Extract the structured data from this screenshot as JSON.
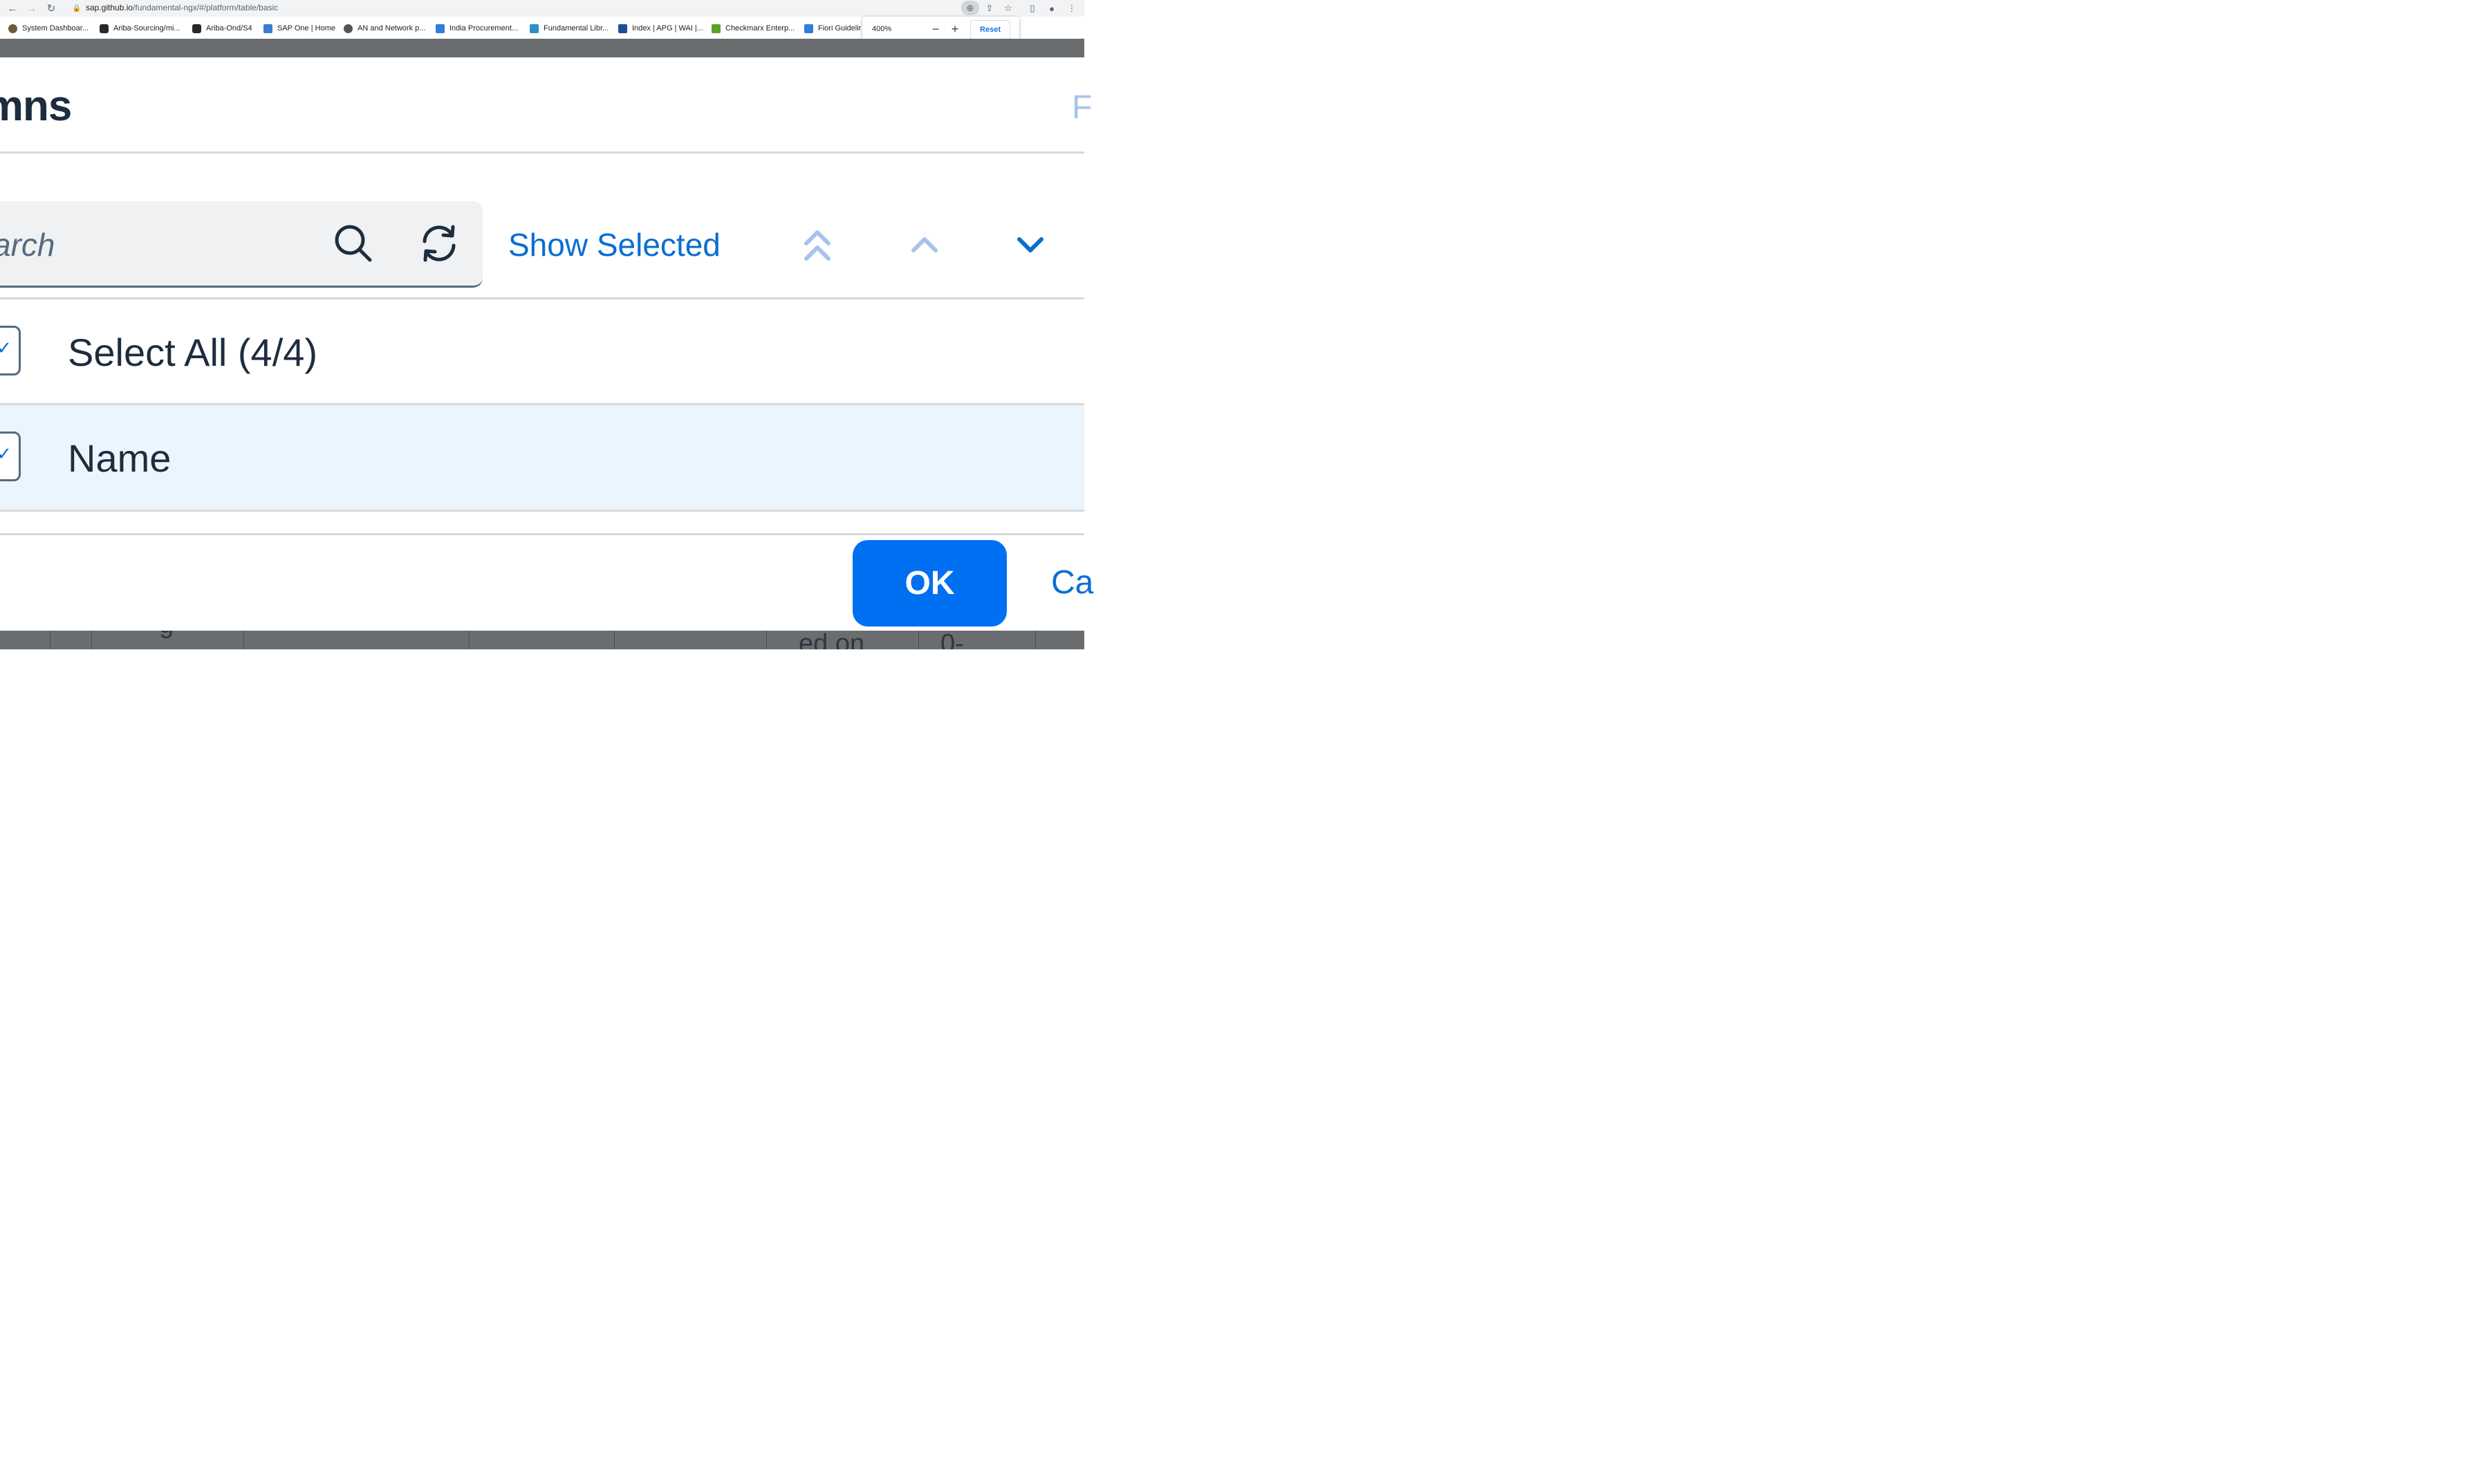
{
  "browser": {
    "url_host": "sap.github.io",
    "url_path": "/fundamental-ngx/#/platform/table/basic",
    "bookmarks": [
      {
        "label": "System Dashboar...",
        "icon": "ariba-icon"
      },
      {
        "label": "Ariba-Sourcing/mi...",
        "icon": "github-icon"
      },
      {
        "label": "Ariba-Ond/S4",
        "icon": "github-icon"
      },
      {
        "label": "SAP One | Home",
        "icon": "sap-one-icon"
      },
      {
        "label": "AN and Network p...",
        "icon": "globe-icon"
      },
      {
        "label": "India Procurement...",
        "icon": "sap-icon"
      },
      {
        "label": "Fundamental Libr...",
        "icon": "fundamental-icon"
      },
      {
        "label": "Index | APG | WAI |...",
        "icon": "w3-icon"
      },
      {
        "label": "Checkmarx Enterp...",
        "icon": "checkmarx-icon"
      },
      {
        "label": "Fiori Guidelir",
        "icon": "sap-icon"
      }
    ],
    "zoom": {
      "value": "400%",
      "minus": "−",
      "plus": "+",
      "reset": "Reset"
    }
  },
  "dialog": {
    "title_fragment": "umns",
    "title_right_fragment": "F",
    "search_placeholder": "arch",
    "show_selected": "Show Selected",
    "select_all": "Select All (4/4)",
    "rows": [
      {
        "label": "Name",
        "checked": true
      }
    ],
    "ok": "OK",
    "cancel_fragment": "Ca"
  },
  "background_fragments": {
    "left": "g",
    "right1": "ed on",
    "right2": "0-"
  },
  "colors": {
    "accent": "#0a6ed1",
    "ok_button": "#0070f2",
    "selected_row": "#ebf5fe",
    "overlay": "#6a6d70",
    "text": "#1d2d3e"
  }
}
